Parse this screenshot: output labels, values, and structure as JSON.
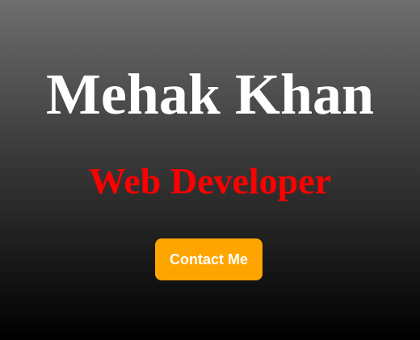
{
  "hero": {
    "name": "Mehak Khan",
    "role": "Web Developer",
    "contact_label": "Contact Me"
  },
  "colors": {
    "name_text": "#ffffff",
    "role_text": "#ff0000",
    "button_bg": "#ffa500",
    "button_text": "#ffffff"
  }
}
